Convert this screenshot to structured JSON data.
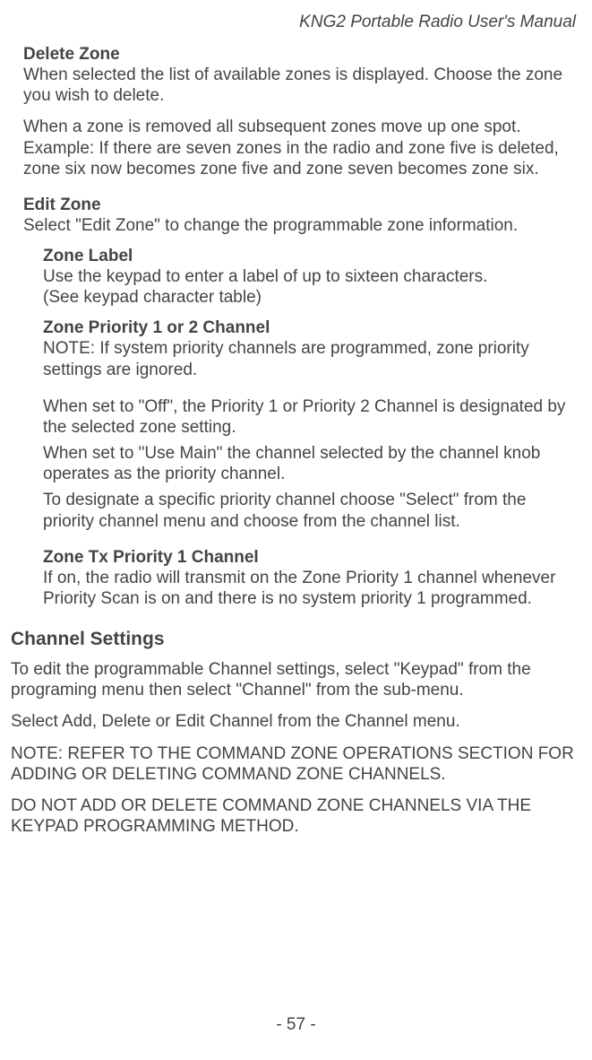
{
  "running_header": "KNG2 Portable Radio User's Manual",
  "deleteZone": {
    "heading": "Delete Zone",
    "p1": "When selected the list of available zones is displayed. Choose the zone you wish to delete.",
    "p2": "When a zone is removed all subsequent zones move up one spot. Example: If there are seven zones in the radio and zone five is deleted, zone six now becomes zone five and zone seven becomes zone six."
  },
  "editZone": {
    "heading": "Edit Zone",
    "p1": "Select \"Edit Zone\" to change the programmable zone information.",
    "zoneLabel": {
      "heading": "Zone Label",
      "p1": "Use the keypad to enter a label of up to sixteen characters.",
      "p2": "(See keypad character table)"
    },
    "zonePriority": {
      "heading": "Zone Priority 1 or 2 Channel",
      "note": "NOTE: If system priority channels are programmed, zone priority settings are ignored.",
      "p1": "When set to \"Off\", the Priority 1 or Priority 2 Channel is designated by the selected zone setting.",
      "p2": "When set to \"Use Main\" the channel selected by the channel knob operates as the priority channel.",
      "p3": "To designate a specific priority channel choose \"Select\" from the priority channel menu and choose from the channel list."
    },
    "zoneTx": {
      "heading": "Zone Tx  Priority 1 Channel",
      "p1": "If on, the radio will transmit on the Zone Priority 1 channel whenever Priority Scan is on and there is no system priority 1 programmed."
    }
  },
  "channelSettings": {
    "heading": "Channel Settings",
    "p1": "To edit the programmable Channel settings, select \"Keypad\" from the programing menu then select \"Channel\" from the sub-menu.",
    "p2": "Select Add, Delete or Edit Channel from the Channel menu.",
    "p3": "NOTE: REFER TO THE COMMAND ZONE OPERATIONS SECTION FOR ADDING OR DELETING COMMAND ZONE CHANNELS.",
    "p4": "DO NOT ADD OR DELETE COMMAND ZONE CHANNELS VIA THE KEYPAD PROGRAMMING METHOD."
  },
  "page_number": "- 57 -"
}
